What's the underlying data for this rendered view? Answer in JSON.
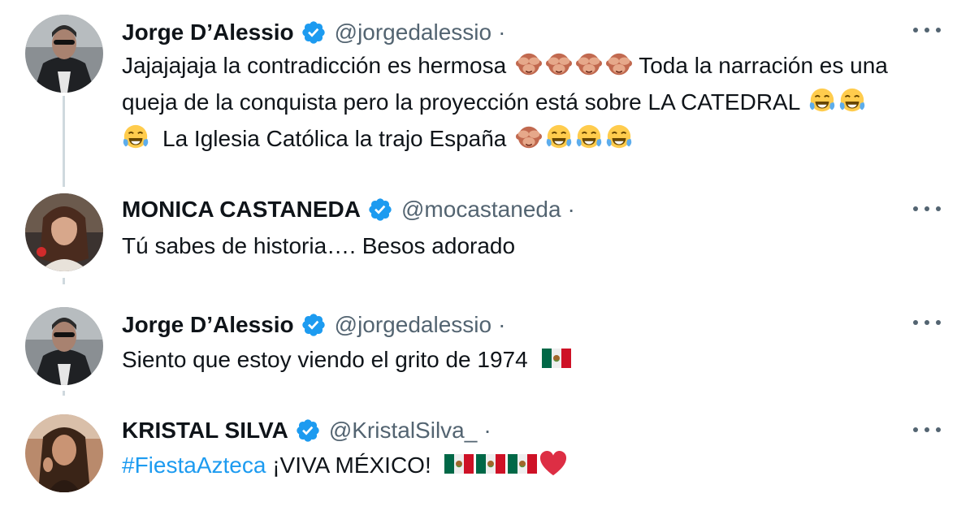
{
  "tweets": [
    {
      "name": "Jorge D’Alessio",
      "handle": "@jorgedalessio",
      "separator": "·",
      "lines": [
        "Jajajajaja la contradicción es hermosa",
        "Toda la narración es una",
        "queja de la conquista pero la proyección está sobre LA CATEDRAL",
        "La Iglesia Católica la trajo España"
      ],
      "emojis": [
        "see-no-evil-monkey",
        "see-no-evil-monkey",
        "see-no-evil-monkey",
        "see-no-evil-monkey",
        "tears-of-joy",
        "tears-of-joy",
        "tears-of-joy",
        "see-no-evil-monkey",
        "tears-of-joy",
        "tears-of-joy",
        "tears-of-joy"
      ]
    },
    {
      "name": "MONICA CASTANEDA",
      "handle": "@mocastaneda",
      "separator": "·",
      "lines": [
        "Tú sabes de historia…. Besos adorado"
      ]
    },
    {
      "name": "Jorge D’Alessio",
      "handle": "@jorgedalessio",
      "separator": "·",
      "lines": [
        "Siento que estoy viendo el grito de 1974"
      ],
      "emojis": [
        "mexico-flag"
      ]
    },
    {
      "name": "KRISTAL SILVA",
      "handle": "@KristalSilva_",
      "separator": "·",
      "hashtag": "#FiestaAzteca",
      "lines": [
        "¡VIVA MÉXICO!"
      ],
      "emojis": [
        "mexico-flag",
        "mexico-flag",
        "mexico-flag",
        "red-heart"
      ]
    }
  ],
  "colors": {
    "text": "#0f1419",
    "secondary": "#536471",
    "link": "#1d9bf0",
    "verified": "#1d9bf0",
    "thread_line": "#cfd9de"
  }
}
